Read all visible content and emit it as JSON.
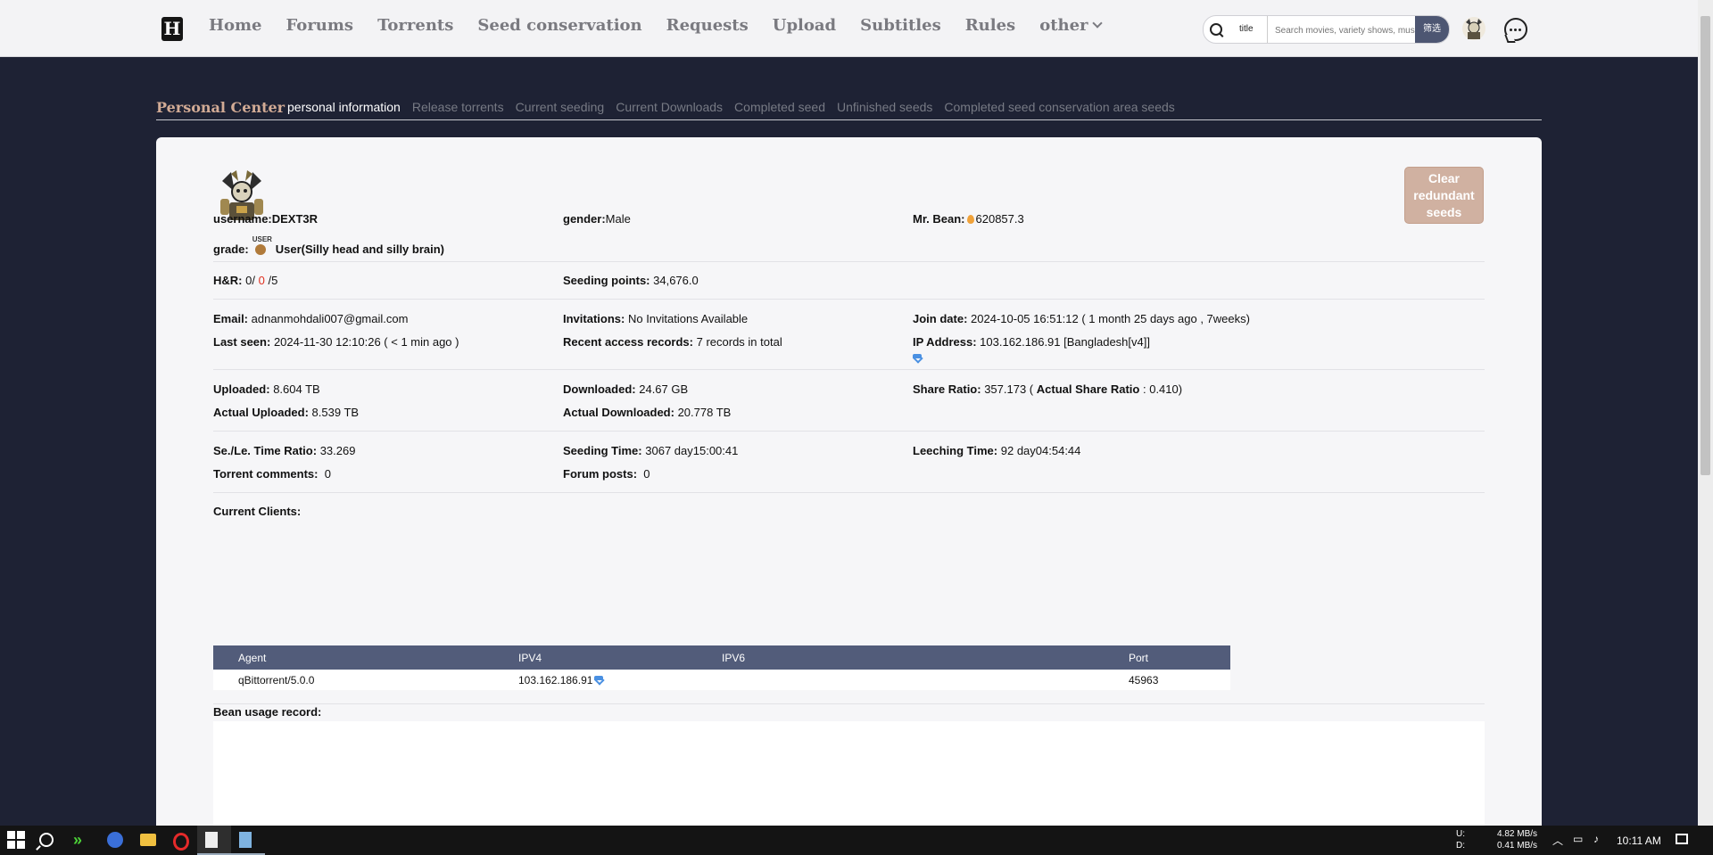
{
  "nav": {
    "logo": "H",
    "links": [
      "Home",
      "Forums",
      "Torrents",
      "Seed conservation",
      "Requests",
      "Upload",
      "Subtitles",
      "Rules",
      "other"
    ],
    "search": {
      "type": "title",
      "placeholder": "Search movies, variety shows, music, programs",
      "button": "筛选"
    }
  },
  "subtabs": {
    "title": "Personal Center",
    "tabs": [
      "personal information",
      "Release torrents",
      "Current seeding",
      "Current Downloads",
      "Completed seed",
      "Unfinished seeds",
      "Completed seed conservation area seeds"
    ],
    "active": 0
  },
  "profile": {
    "clear_button": [
      "Clear",
      "redundant",
      "seeds"
    ],
    "username_label": "username:",
    "username": "DEXT3R",
    "gender_label": "gender:",
    "gender": "Male",
    "bean_label": "Mr. Bean:",
    "bean": "620857.3",
    "grade_label": "grade:",
    "grade_badge": "USER",
    "grade": "User(Silly head and silly brain)",
    "hr_label": "H&R:",
    "hr_a": "0/",
    "hr_b": "0",
    "hr_c": "/5",
    "seeding_points_label": "Seeding points:",
    "seeding_points": "34,676.0",
    "email_label": "Email:",
    "email": "adnanmohdali007@gmail.com",
    "invitations_label": "Invitations:",
    "invitations": "No Invitations Available",
    "join_label": "Join date:",
    "join": "2024-10-05 16:51:12 ( 1 month 25 days ago , 7weeks)",
    "last_seen_label": "Last seen:",
    "last_seen": "2024-11-30 12:10:26 ( < 1 min ago )",
    "access_label": "Recent access records:",
    "access": "7 records in total",
    "ip_label": "IP Address:",
    "ip": "103.162.186.91 [Bangladesh[v4]]",
    "uploaded_label": "Uploaded:",
    "uploaded": "8.604 TB",
    "downloaded_label": "Downloaded:",
    "downloaded": "24.67 GB",
    "ratio_label": "Share Ratio:",
    "ratio": "357.173 (",
    "actual_ratio_label": "Actual Share Ratio",
    "actual_ratio": ": 0.410)",
    "actual_up_label": "Actual Uploaded:",
    "actual_up": "8.539 TB",
    "actual_down_label": "Actual Downloaded:",
    "actual_down": "20.778 TB",
    "time_ratio_label": "Se./Le. Time Ratio:",
    "time_ratio": "33.269",
    "seeding_time_label": "Seeding Time:",
    "seeding_time": "3067 day15:00:41",
    "leeching_time_label": "Leeching Time:",
    "leeching_time": "92 day04:54:44",
    "comments_label": "Torrent comments:",
    "comments": "0",
    "posts_label": "Forum posts:",
    "posts": "0",
    "clients_label": "Current Clients:",
    "clients": {
      "headers": [
        "Agent",
        "IPV4",
        "IPV6",
        "Port"
      ],
      "rows": [
        [
          "qBittorrent/5.0.0",
          "103.162.186.91",
          "",
          "45963"
        ]
      ]
    },
    "bean_record_label": "Bean usage record:"
  },
  "taskbar": {
    "net_up_label": "U:",
    "net_up": "4.82 MB/s",
    "net_down_label": "D:",
    "net_down": "0.41 MB/s",
    "clock": "10:11 AM"
  }
}
